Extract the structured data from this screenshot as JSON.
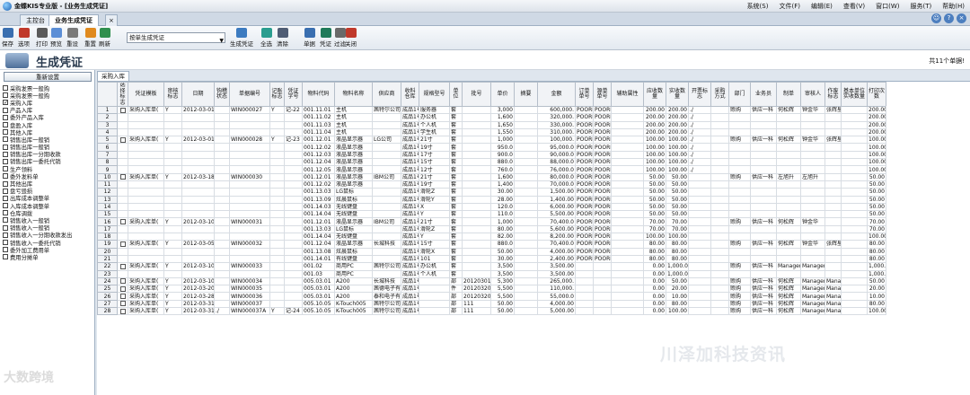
{
  "app": {
    "title": "金蝶KIS专业版 - [业务生成凭证]",
    "menu": [
      "系统(S)",
      "文件(F)",
      "编辑(E)",
      "查看(V)",
      "窗口(W)",
      "服务(T)",
      "帮助(H)"
    ]
  },
  "tabs": [
    "主控台",
    "业务生成凭证"
  ],
  "toolbar": {
    "buttons": [
      "保存",
      "选项",
      "打印",
      "预览",
      "重设",
      "重置",
      "刷新"
    ],
    "select": "按单生成凭证",
    "buttons2": [
      "生成凭证",
      "全选",
      "清除",
      "单据",
      "凭证",
      "过滤",
      "关闭"
    ]
  },
  "page": {
    "title": "生成凭证",
    "count": "共11个单据!",
    "reset": "重新设置",
    "gridtab": "采购入库"
  },
  "bills": [
    {
      "label": "采购发票一般购",
      "checked": false
    },
    {
      "label": "采购发票一般购",
      "checked": false
    },
    {
      "label": "采购入库",
      "checked": true
    },
    {
      "label": "产品入库",
      "checked": false
    },
    {
      "label": "委外产品入库",
      "checked": false
    },
    {
      "label": "盘盈入库",
      "checked": false
    },
    {
      "label": "其他入库",
      "checked": false
    },
    {
      "label": "销售出库一般销",
      "checked": false
    },
    {
      "label": "销售出库一般销",
      "checked": false
    },
    {
      "label": "销售出库一分期收款",
      "checked": false
    },
    {
      "label": "销售出库一委托代销",
      "checked": false
    },
    {
      "label": "生产领料",
      "checked": false
    },
    {
      "label": "委外发料单",
      "checked": false
    },
    {
      "label": "其他出库",
      "checked": false
    },
    {
      "label": "盘亏毁损",
      "checked": false
    },
    {
      "label": "出库成本调整单",
      "checked": false
    },
    {
      "label": "入库成本调整单",
      "checked": false
    },
    {
      "label": "仓库调拨",
      "checked": false
    },
    {
      "label": "销售收入一般销",
      "checked": false
    },
    {
      "label": "销售收入一般销",
      "checked": false
    },
    {
      "label": "销售收入一分期收款发出",
      "checked": false
    },
    {
      "label": "销售收入一委托代销",
      "checked": false
    },
    {
      "label": "委外加工费用单",
      "checked": false
    },
    {
      "label": "费用分摊单",
      "checked": false
    }
  ],
  "columns": [
    "",
    "选择标志",
    "凭证模板",
    "审核标志",
    "日期",
    "钩稽状态",
    "单据编号",
    "记账标志",
    "凭证字号",
    "物料代码",
    "物料名称",
    "供应商",
    "收料仓库",
    "规格型号",
    "单位",
    "批号",
    "单价",
    "摘要",
    "金额",
    "订单单号",
    "源单单号",
    "辅助属性",
    "应收数量",
    "实收数量",
    "开票标志",
    "采购方式",
    "部门",
    "业务员",
    "制单",
    "审核人",
    "作废标志",
    "基本单位实收数量",
    "打印次数"
  ],
  "rows": [
    [
      "1",
      "",
      "采购入库单(",
      "Y",
      "2012-03-01",
      "",
      "WIN000027",
      "Y",
      "记-22",
      "001.11.01",
      "主机",
      "茜特尔公司(",
      "成品1号",
      "服务器",
      "套",
      "",
      "3,000",
      "",
      "600,000.",
      "POORD",
      "POORD",
      "",
      "200.00",
      "200.00",
      "./",
      "",
      "赊购",
      "供应一科",
      "何松辉",
      "钟金华",
      "张辉星",
      "",
      "200.00",
      "1"
    ],
    [
      "2",
      "",
      "",
      "",
      "",
      "",
      "",
      "",
      "",
      "001.11.02",
      "主机",
      "",
      "成品1号",
      "办公机",
      "套",
      "",
      "1,600",
      "",
      "320,000.",
      "POORD",
      "POORD",
      "",
      "200.00",
      "200.00",
      "./",
      "",
      "",
      "",
      "",
      "",
      "",
      "",
      "200.00",
      ""
    ],
    [
      "3",
      "",
      "",
      "",
      "",
      "",
      "",
      "",
      "",
      "001.11.03",
      "主机",
      "",
      "成品1号",
      "个人机",
      "套",
      "",
      "1,650",
      "",
      "330,000.",
      "POORD",
      "POORD",
      "",
      "200.00",
      "200.00",
      "./",
      "",
      "",
      "",
      "",
      "",
      "",
      "",
      "200.00",
      ""
    ],
    [
      "4",
      "",
      "",
      "",
      "",
      "",
      "",
      "",
      "",
      "001.11.04",
      "主机",
      "",
      "成品1号",
      "学生机",
      "套",
      "",
      "1,550",
      "",
      "310,000.",
      "POORD",
      "POORD",
      "",
      "200.00",
      "200.00",
      "./",
      "",
      "",
      "",
      "",
      "",
      "",
      "",
      "200.00",
      ""
    ],
    [
      "5",
      "",
      "采购入库单(",
      "Y",
      "2012-03-01",
      "",
      "WIN000028",
      "Y",
      "记-23",
      "001.12.01",
      "液晶显示器",
      "LG公司",
      "成品1号",
      "21寸",
      "套",
      "",
      "1,000",
      "",
      "100,000.",
      "POORD",
      "POORD",
      "",
      "100.00",
      "100.00",
      "./",
      "",
      "赊购",
      "供应一科",
      "何松辉",
      "钟金华",
      "张辉星",
      "",
      "100.00",
      "1"
    ],
    [
      "6",
      "",
      "",
      "",
      "",
      "",
      "",
      "",
      "",
      "001.12.02",
      "液晶显示器",
      "",
      "成品1号",
      "19寸",
      "套",
      "",
      "950.0",
      "",
      "95,000.0",
      "POORD",
      "POORD",
      "",
      "100.00",
      "100.00",
      "./",
      "",
      "",
      "",
      "",
      "",
      "",
      "",
      "100.00",
      ""
    ],
    [
      "7",
      "",
      "",
      "",
      "",
      "",
      "",
      "",
      "",
      "001.12.03",
      "液晶显示器",
      "",
      "成品1号",
      "17寸",
      "套",
      "",
      "900.0",
      "",
      "90,000.0",
      "POORD",
      "POORD",
      "",
      "100.00",
      "100.00",
      "./",
      "",
      "",
      "",
      "",
      "",
      "",
      "",
      "100.00",
      ""
    ],
    [
      "8",
      "",
      "",
      "",
      "",
      "",
      "",
      "",
      "",
      "001.12.04",
      "液晶显示器",
      "",
      "成品1号",
      "15寸",
      "套",
      "",
      "880.0",
      "",
      "88,000.0",
      "POORD",
      "POORD",
      "",
      "100.00",
      "100.00",
      "./",
      "",
      "",
      "",
      "",
      "",
      "",
      "",
      "100.00",
      ""
    ],
    [
      "9",
      "",
      "",
      "",
      "",
      "",
      "",
      "",
      "",
      "001.12.05",
      "液晶显示器",
      "",
      "成品1号",
      "12寸",
      "套",
      "",
      "760.0",
      "",
      "76,000.0",
      "POORD",
      "POORD",
      "",
      "100.00",
      "100.00",
      "./",
      "",
      "",
      "",
      "",
      "",
      "",
      "",
      "100.00",
      ""
    ],
    [
      "10",
      "",
      "采购入库单(",
      "Y",
      "2012-03-18",
      "",
      "WIN000030",
      "",
      "",
      "001.12.01",
      "液晶显示器",
      "IBM公司",
      "成品1号",
      "21寸",
      "套",
      "",
      "1,600",
      "",
      "80,000.0",
      "POORD",
      "POORD",
      "",
      "50.00",
      "50.00",
      "",
      "",
      "赊购",
      "供应一科",
      "左旭升",
      "左旭升",
      "",
      "",
      "50.00",
      "0"
    ],
    [
      "11",
      "",
      "",
      "",
      "",
      "",
      "",
      "",
      "",
      "001.12.02",
      "液晶显示器",
      "",
      "成品1号",
      "19寸",
      "套",
      "",
      "1,400",
      "",
      "70,000.0",
      "POORD",
      "POORD",
      "",
      "50.00",
      "50.00",
      "",
      "",
      "",
      "",
      "",
      "",
      "",
      "",
      "50.00",
      ""
    ],
    [
      "12",
      "",
      "",
      "",
      "",
      "",
      "",
      "",
      "",
      "001.13.03",
      "LG鼠标",
      "",
      "成品1号",
      "滑轮Z",
      "套",
      "",
      "30.00",
      "",
      "1,500.00",
      "POORD",
      "POORD",
      "",
      "50.00",
      "50.00",
      "",
      "",
      "",
      "",
      "",
      "",
      "",
      "",
      "50.00",
      ""
    ],
    [
      "13",
      "",
      "",
      "",
      "",
      "",
      "",
      "",
      "",
      "001.13.09",
      "炫晨鼠标",
      "",
      "成品1号",
      "滑轮Y",
      "套",
      "",
      "28.00",
      "",
      "1,400.00",
      "POORD",
      "POORD",
      "",
      "50.00",
      "50.00",
      "",
      "",
      "",
      "",
      "",
      "",
      "",
      "",
      "50.00",
      ""
    ],
    [
      "14",
      "",
      "",
      "",
      "",
      "",
      "",
      "",
      "",
      "001.14.03",
      "无线键盘",
      "",
      "成品1号",
      "X",
      "套",
      "",
      "120.0",
      "",
      "6,000.00",
      "POORD",
      "POORD",
      "",
      "50.00",
      "50.00",
      "",
      "",
      "",
      "",
      "",
      "",
      "",
      "",
      "50.00",
      ""
    ],
    [
      "15",
      "",
      "",
      "",
      "",
      "",
      "",
      "",
      "",
      "001.14.04",
      "无线键盘",
      "",
      "成品1号",
      "Y",
      "套",
      "",
      "110.0",
      "",
      "5,500.00",
      "POORD",
      "POORD",
      "",
      "50.00",
      "50.00",
      "",
      "",
      "",
      "",
      "",
      "",
      "",
      "",
      "50.00",
      ""
    ],
    [
      "16",
      "",
      "采购入库单(",
      "Y",
      "2012-03-10",
      "",
      "WIN000031",
      "",
      "",
      "001.12.01",
      "液晶显示器",
      "IBM公司",
      "成品1号",
      "21寸",
      "套",
      "",
      "1,000",
      "",
      "70,400.0",
      "POORD",
      "POORD",
      "",
      "70.00",
      "70.00",
      "",
      "",
      "赊购",
      "供应一科",
      "何松辉",
      "钟金华",
      "",
      "",
      "70.00",
      "0"
    ],
    [
      "17",
      "",
      "",
      "",
      "",
      "",
      "",
      "",
      "",
      "001.13.03",
      "LG鼠标",
      "",
      "成品1号",
      "滑轮Z",
      "套",
      "",
      "80.00",
      "",
      "5,600.00",
      "POORD",
      "POORD",
      "",
      "70.00",
      "70.00",
      "",
      "",
      "",
      "",
      "",
      "",
      "",
      "",
      "70.00",
      ""
    ],
    [
      "18",
      "",
      "",
      "",
      "",
      "",
      "",
      "",
      "",
      "001.14.04",
      "无线键盘",
      "",
      "成品1号",
      "Y",
      "套",
      "",
      "82.00",
      "",
      "8,200.00",
      "POORD",
      "POORD",
      "",
      "100.00",
      "100.00",
      "",
      "",
      "",
      "",
      "",
      "",
      "",
      "",
      "100.00",
      ""
    ],
    [
      "19",
      "",
      "采购入库单(",
      "Y",
      "2012-03-05",
      "",
      "WIN000032",
      "",
      "",
      "001.12.04",
      "液晶显示器",
      "长城科技",
      "成品1号",
      "15寸",
      "套",
      "",
      "880.0",
      "",
      "70,400.0",
      "POORD",
      "POORD",
      "",
      "80.00",
      "80.00",
      "",
      "",
      "赊购",
      "供应一科",
      "何松辉",
      "钟金华",
      "张辉星",
      "",
      "80.00",
      "0"
    ],
    [
      "20",
      "",
      "",
      "",
      "",
      "",
      "",
      "",
      "",
      "001.13.08",
      "炫晨鼠标",
      "",
      "成品1号",
      "滑轮X",
      "套",
      "",
      "50.00",
      "",
      "4,000.00",
      "POORD",
      "POORD",
      "",
      "80.00",
      "80.00",
      "",
      "",
      "",
      "",
      "",
      "",
      "",
      "",
      "80.00",
      ""
    ],
    [
      "21",
      "",
      "",
      "",
      "",
      "",
      "",
      "",
      "",
      "001.14.01",
      "有线键盘",
      "",
      "成品1号",
      "101",
      "套",
      "",
      "30.00",
      "",
      "2,400.00",
      "POORD",
      "POORD",
      "",
      "80.00",
      "80.00",
      "",
      "",
      "",
      "",
      "",
      "",
      "",
      "",
      "80.00",
      ""
    ],
    [
      "22",
      "",
      "采购入库单(",
      "Y",
      "2012-03-10",
      "",
      "WIN000033",
      "",
      "",
      "001.02",
      "商用PC",
      "茜特尔公司(",
      "成品1号",
      "办公机",
      "套",
      "",
      "3,500",
      "",
      "3,500.00",
      "",
      "",
      "",
      "0.00",
      "1,000.00",
      "",
      "",
      "赊购",
      "供应一科",
      "Manager",
      "Manager",
      "",
      "",
      "1,000.00",
      "0"
    ],
    [
      "23",
      "",
      "",
      "",
      "",
      "",
      "",
      "",
      "",
      "001.03",
      "商用PC",
      "",
      "成品1号",
      "个人机",
      "套",
      "",
      "3,500",
      "",
      "3,500.00",
      "",
      "",
      "",
      "0.00",
      "1,000.00",
      "",
      "",
      "",
      "",
      "",
      "",
      "",
      "",
      "1,000.00",
      ""
    ],
    [
      "24",
      "",
      "采购入库单(",
      "Y",
      "2012-03-10",
      "",
      "WIN000034",
      "",
      "",
      "005.03.01",
      "A200",
      "长城科技",
      "成品1号",
      "",
      "部",
      "20120301001",
      "5,300",
      "",
      "265,000.",
      "",
      "",
      "",
      "0.00",
      "50.00",
      "",
      "",
      "赊购",
      "供应一科",
      "何松辉",
      "Manager",
      "Manager",
      "",
      "50.00",
      "0"
    ],
    [
      "25",
      "",
      "采购入库单(",
      "Y",
      "2012-03-20",
      "",
      "WIN000035",
      "",
      "",
      "005.03.01",
      "A200",
      "茜德电子有",
      "成品1号",
      "",
      "件",
      "201203200001",
      "5,500",
      "",
      "110,000.",
      "",
      "",
      "",
      "0.00",
      "20.00",
      "",
      "",
      "赊购",
      "供应一科",
      "何松辉",
      "Manager",
      "Manager",
      "",
      "20.00",
      "0"
    ],
    [
      "26",
      "",
      "采购入库单(",
      "Y",
      "2012-03-28",
      "",
      "WIN000036",
      "",
      "",
      "005.03.01",
      "A200",
      "泰和电子有限",
      "成品1号",
      "",
      "部",
      "20120320001",
      "5,500",
      "",
      "55,000.0",
      "",
      "",
      "",
      "0.00",
      "10.00",
      "",
      "",
      "赊购",
      "供应一科",
      "何松辉",
      "Manager",
      "Manager",
      "",
      "10.00",
      "0"
    ],
    [
      "27",
      "",
      "采购入库单(",
      "Y",
      "2012-03-31",
      "",
      "WIN000037",
      "",
      "",
      "005.10.05",
      "K-Touch005",
      "茜特尔公司(",
      "成品1号",
      "",
      "部",
      "111",
      "50.00",
      "",
      "4,000.00",
      "",
      "",
      "",
      "0.00",
      "80.00",
      "",
      "",
      "赊购",
      "供应一科",
      "何松辉",
      "Manager",
      "Manager",
      "",
      "80.00",
      "0"
    ],
    [
      "28",
      "",
      "采购入库单(",
      "Y",
      "2012-03-31",
      "./",
      "WIN000037A",
      "Y",
      "记-24",
      "005.10.05",
      "K-Touch005",
      "茜特尔公司(",
      "成品1号",
      "",
      "部",
      "111",
      "50.00",
      "",
      "5,000.00",
      "",
      "",
      "",
      "0.00",
      "100.00",
      "",
      "",
      "赊购",
      "供应一科",
      "何松辉",
      "Manager",
      "Manager",
      "",
      "100.00",
      "0"
    ]
  ],
  "watermarks": {
    "left": "大数跨境",
    "right": "川泽加科技资讯"
  }
}
